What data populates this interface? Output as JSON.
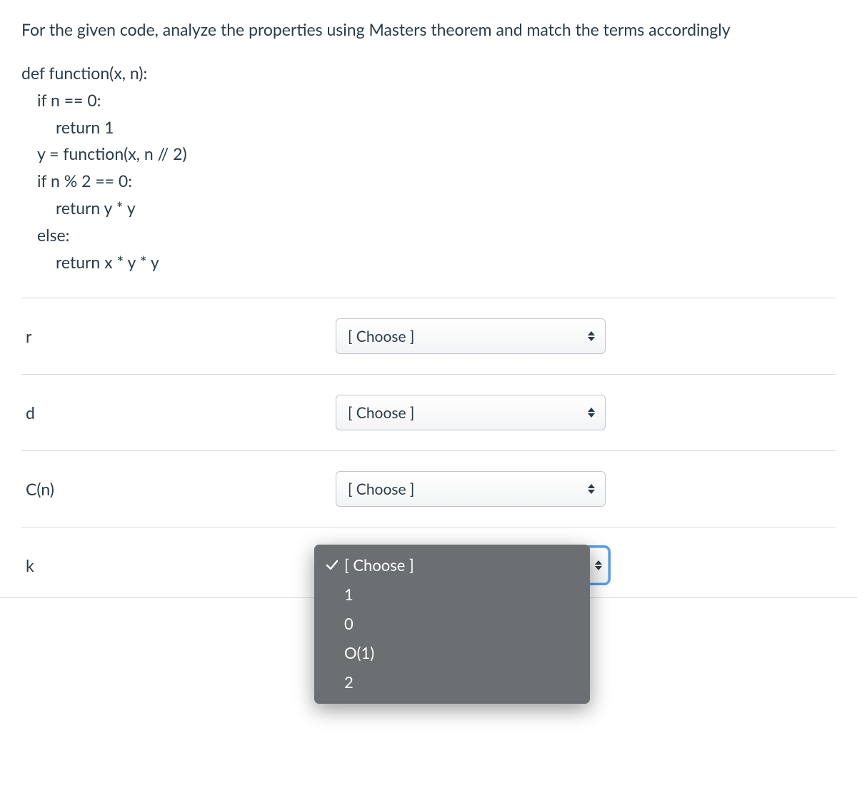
{
  "question": {
    "prompt": "For the given code, analyze the properties using Masters theorem and match the terms accordingly",
    "code_lines": [
      {
        "text": "def function(x, n):",
        "indent": 0
      },
      {
        "text": "if n == 0:",
        "indent": 1
      },
      {
        "text": "return 1",
        "indent": 2
      },
      {
        "text": "y = function(x, n // 2)",
        "indent": 1
      },
      {
        "text": "if n % 2 == 0:",
        "indent": 1
      },
      {
        "text": "return y * y",
        "indent": 2
      },
      {
        "text": "else:",
        "indent": 1
      },
      {
        "text": "return x * y * y",
        "indent": 2
      }
    ]
  },
  "choose_placeholder": "[ Choose ]",
  "rows": [
    {
      "label": "r",
      "value": "[ Choose ]"
    },
    {
      "label": "d",
      "value": "[ Choose ]"
    },
    {
      "label": "C(n)",
      "value": "[ Choose ]"
    },
    {
      "label": "k",
      "value": "[ Choose ]"
    }
  ],
  "dropdown_options": [
    {
      "label": "[ Choose ]",
      "selected": true
    },
    {
      "label": "1",
      "selected": false
    },
    {
      "label": "0",
      "selected": false
    },
    {
      "label": "O(1)",
      "selected": false
    },
    {
      "label": "2",
      "selected": false
    }
  ]
}
